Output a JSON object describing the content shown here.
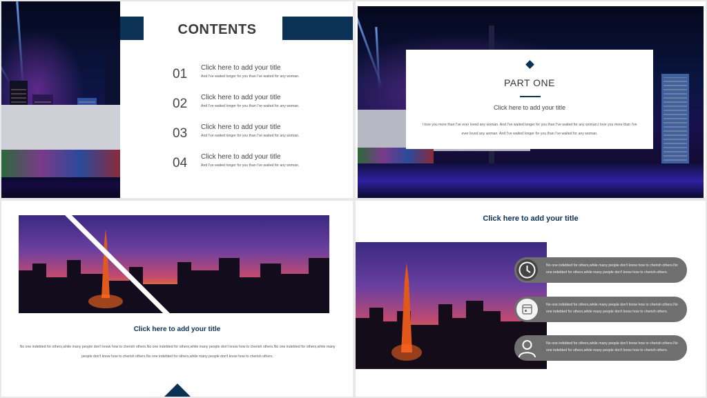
{
  "slide1": {
    "contents_title": "CONTENTS",
    "items": [
      {
        "num": "01",
        "title": "Click here to add your title",
        "sub": "And I've waited longer for you than I've waited for any woman."
      },
      {
        "num": "02",
        "title": "Click here to add your title",
        "sub": "And I've waited longer for you than I've waited for any woman."
      },
      {
        "num": "03",
        "title": "Click here to add your title",
        "sub": "And I've waited longer for you than I've waited for any woman."
      },
      {
        "num": "04",
        "title": "Click here to add your title",
        "sub": "And I've waited longer for you than I've waited for any woman."
      }
    ],
    "accent_color": "#0b3155"
  },
  "slide2": {
    "part": "PART ONE",
    "click_title": "Click here to add your title",
    "body": "I love you more than I've ever loved any woman. And I've waited longer for you than I've waited for any woman.I love you more than I've ever loved any woman. And I've waited longer for you than I've waited for any woman."
  },
  "slide3": {
    "title": "Click here to add your title",
    "body": "No one indebted for others,while many people don't know how to cherish others.No one indebted for others,while many people don't know how to cherish others.No one indebted for others,while many people don't know how to cherish others.No one indebted for others,while many people don't know how to cherish others."
  },
  "slide4": {
    "title": "Click here to add your title",
    "pills": [
      {
        "icon": "clock-icon",
        "text": "No one indebted for others,while many people don't know how to cherish others.No one indebted for others,while many people don't know how to cherish others."
      },
      {
        "icon": "calendar-icon",
        "text": "No one indebted for others,while many people don't know how to cherish others.No one indebted for others,while many people don't know how to cherish others."
      },
      {
        "icon": "user-icon",
        "text": "No one indebted for others,while many people don't know how to cherish others.No one indebted for others,while many people don't know how to cherish others."
      }
    ]
  }
}
